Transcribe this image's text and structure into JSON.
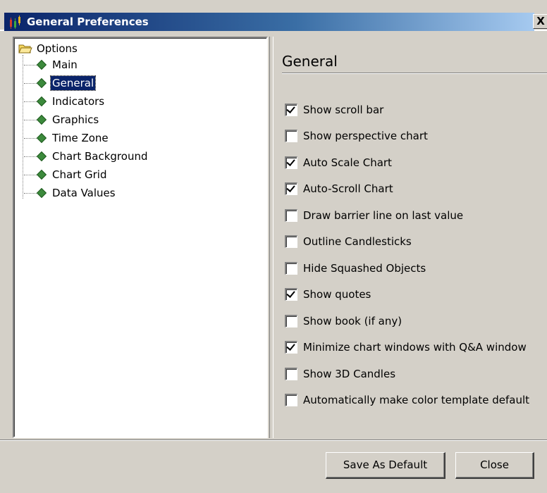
{
  "window": {
    "title": "General Preferences",
    "close_glyph": "X",
    "title_icon": "chart-candlestick-icon"
  },
  "tree": {
    "root_label": "Options",
    "root_icon": "folder-open-icon",
    "items": [
      {
        "label": "Main",
        "selected": false
      },
      {
        "label": "General",
        "selected": true
      },
      {
        "label": "Indicators",
        "selected": false
      },
      {
        "label": "Graphics",
        "selected": false
      },
      {
        "label": "Time Zone",
        "selected": false
      },
      {
        "label": "Chart Background",
        "selected": false
      },
      {
        "label": "Chart Grid",
        "selected": false
      },
      {
        "label": "Data Values",
        "selected": false
      }
    ]
  },
  "panel": {
    "title": "General",
    "options": [
      {
        "label": "Show scroll bar",
        "checked": true
      },
      {
        "label": "Show perspective chart",
        "checked": false
      },
      {
        "label": "Auto Scale Chart",
        "checked": true
      },
      {
        "label": "Auto-Scroll Chart",
        "checked": true
      },
      {
        "label": "Draw barrier line on last value",
        "checked": false
      },
      {
        "label": "Outline Candlesticks",
        "checked": false
      },
      {
        "label": "Hide Squashed Objects",
        "checked": false
      },
      {
        "label": "Show quotes",
        "checked": true
      },
      {
        "label": "Show book (if any)",
        "checked": false
      },
      {
        "label": "Minimize chart windows with Q&A window",
        "checked": true
      },
      {
        "label": "Show 3D Candles",
        "checked": false
      },
      {
        "label": "Automatically make color template default",
        "checked": false
      }
    ]
  },
  "buttons": {
    "save_default": "Save As Default",
    "close": "Close"
  },
  "colors": {
    "titlebar_start": "#0a246a",
    "titlebar_end": "#a6caf0",
    "selection": "#0a246a",
    "tree_diamond": "#3c8a3c"
  }
}
